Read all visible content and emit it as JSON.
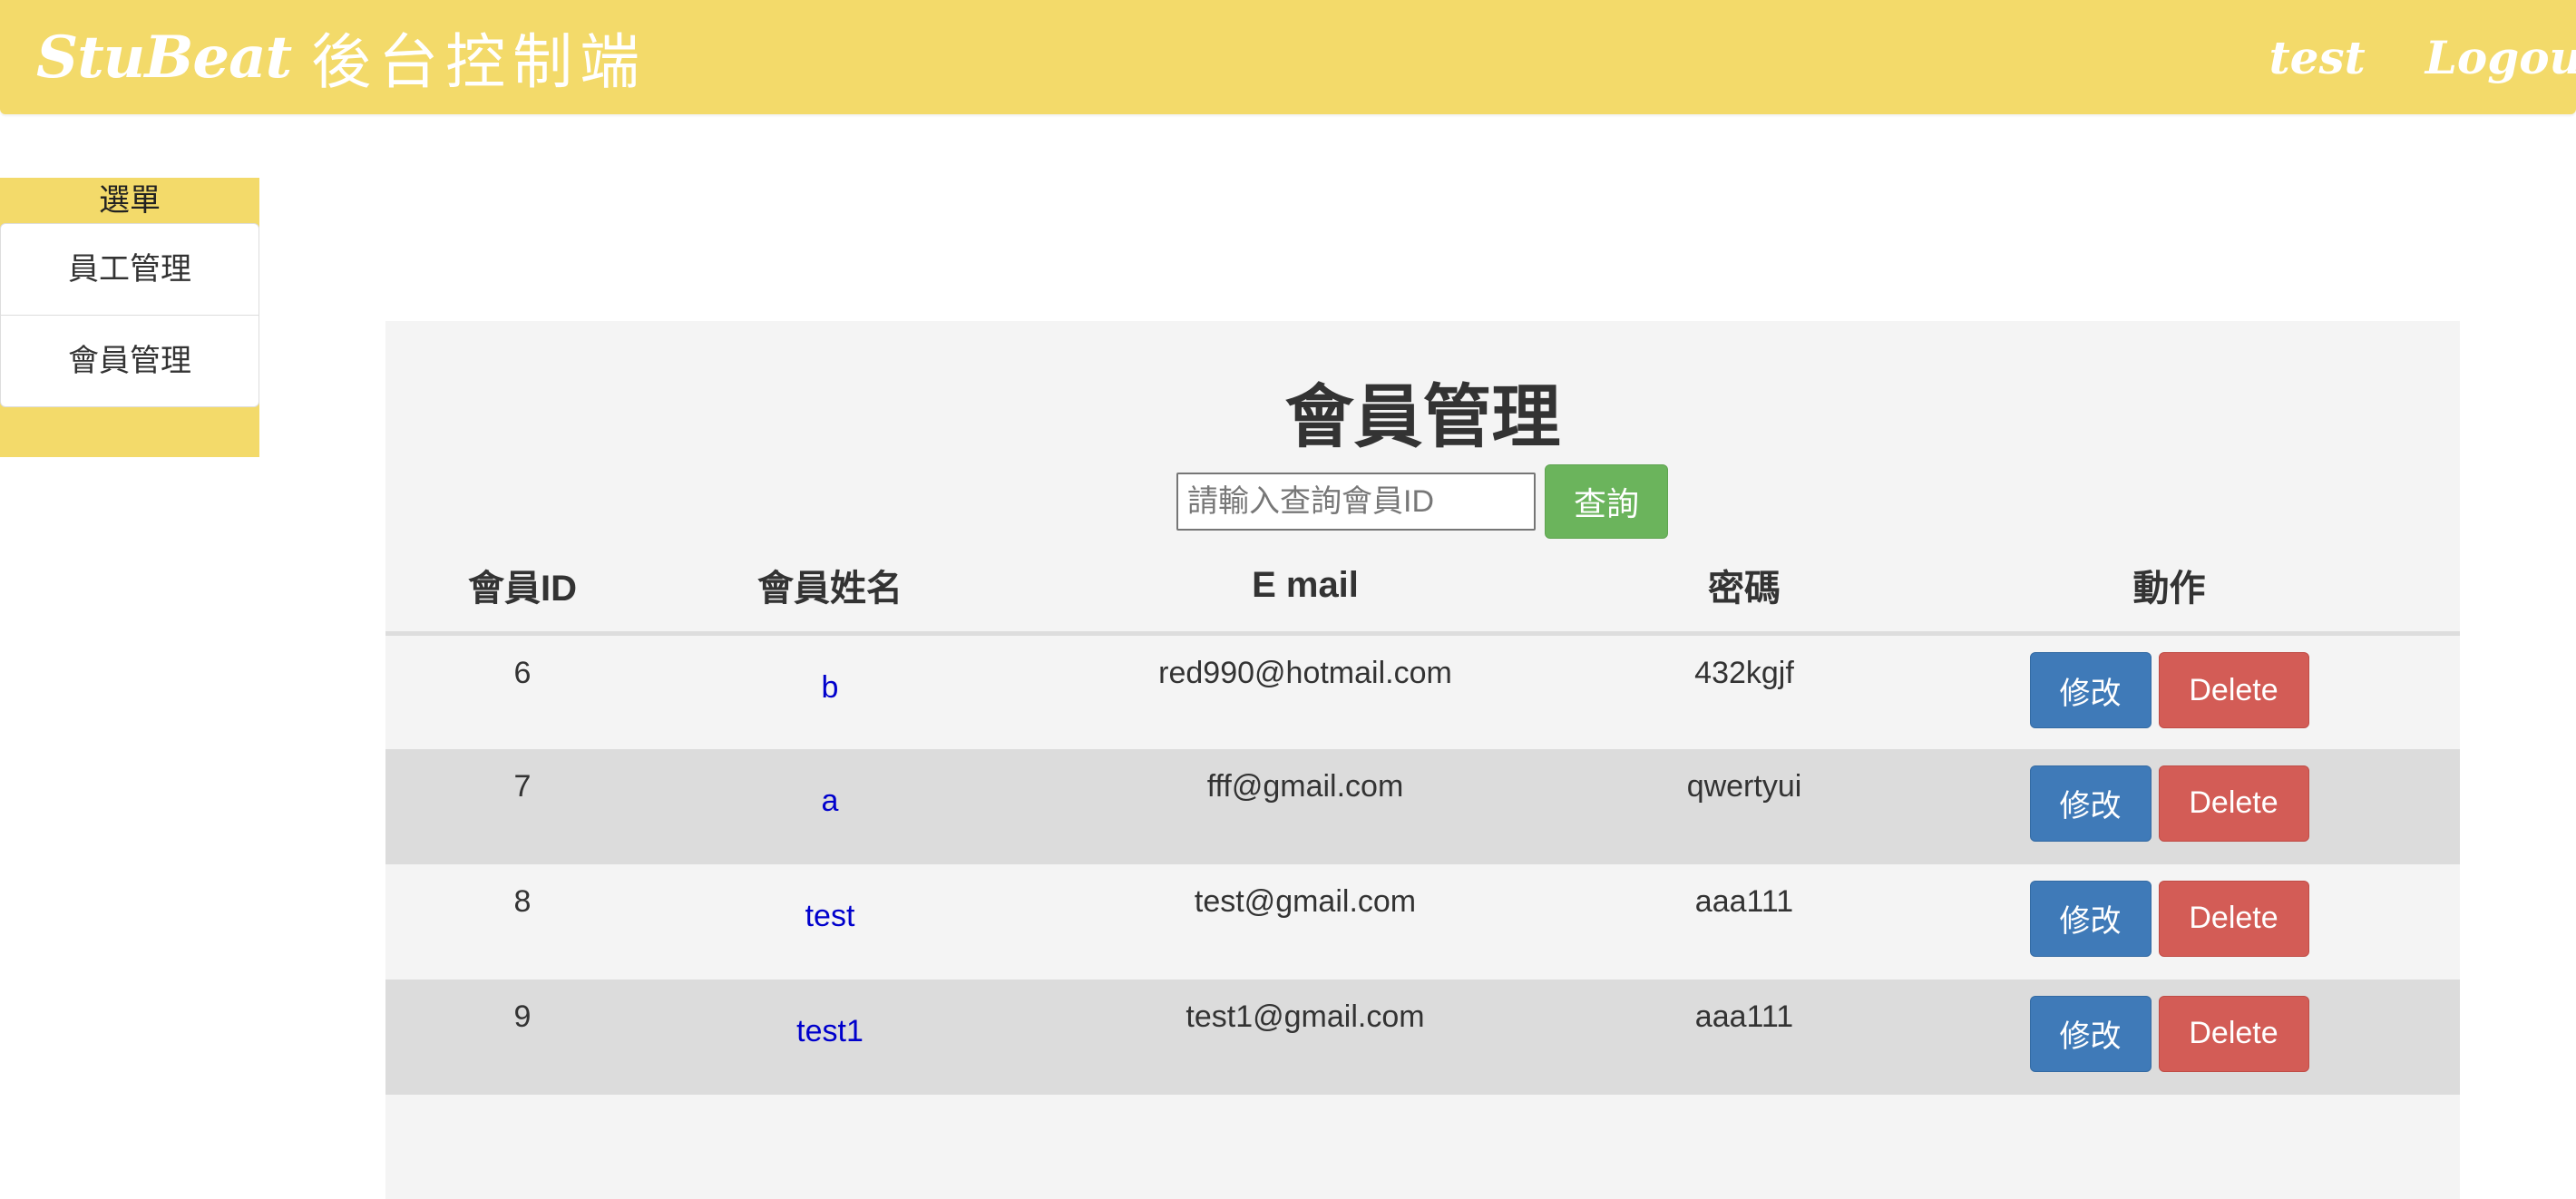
{
  "header": {
    "brand_name": "StuBeat",
    "brand_subtitle": "後台控制端",
    "nav_user": "test",
    "nav_logout": "Logout"
  },
  "sidebar": {
    "title": "選單",
    "items": [
      {
        "label": "員工管理"
      },
      {
        "label": "會員管理"
      }
    ]
  },
  "main": {
    "title": "會員管理",
    "search": {
      "placeholder": "請輸入查詢會員ID",
      "value": "",
      "button_label": "查詢"
    },
    "table": {
      "columns": [
        "會員ID",
        "會員姓名",
        "E mail",
        "密碼",
        "動作"
      ],
      "rows": [
        {
          "id": "6",
          "name": "b",
          "email": "red990@hotmail.com",
          "password": "432kgjf",
          "edit_label": "修改",
          "delete_label": "Delete"
        },
        {
          "id": "7",
          "name": "a",
          "email": "fff@gmail.com",
          "password": "qwertyui",
          "edit_label": "修改",
          "delete_label": "Delete"
        },
        {
          "id": "8",
          "name": "test",
          "email": "test@gmail.com",
          "password": "aaa111",
          "edit_label": "修改",
          "delete_label": "Delete"
        },
        {
          "id": "9",
          "name": "test1",
          "email": "test1@gmail.com",
          "password": "aaa111",
          "edit_label": "修改",
          "delete_label": "Delete"
        }
      ]
    }
  },
  "colors": {
    "header_bg": "#f3da6a",
    "sidebar_bg": "#f3da6a",
    "panel_bg": "#f4f4f4",
    "row_alt_bg": "#dcdcdc",
    "search_button": "#6bb45c",
    "edit_button": "#3f7ab8",
    "delete_button": "#d35c56",
    "name_link": "#0000cc"
  }
}
